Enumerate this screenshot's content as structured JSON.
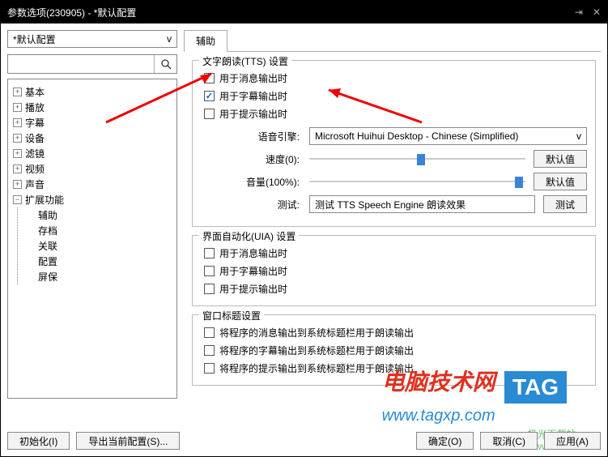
{
  "title": "参数选项(230905) - *默认配置",
  "configSelect": "*默认配置",
  "tree": {
    "items": [
      "基本",
      "播放",
      "字幕",
      "设备",
      "滤镜",
      "视频",
      "声音",
      "扩展功能"
    ],
    "children": [
      "辅助",
      "存档",
      "关联",
      "配置",
      "屏保"
    ]
  },
  "tab": "辅助",
  "tts": {
    "title": "文字朗读(TTS) 设置",
    "chk1": "用于消息输出时",
    "chk2": "用于字幕输出时",
    "chk3": "用于提示输出时",
    "engineLabel": "语音引擎:",
    "engineValue": "Microsoft Huihui Desktop - Chinese (Simplified)",
    "speedLabel": "速度(0):",
    "volumeLabel": "音量(100%):",
    "defaultBtn": "默认值",
    "testLabel": "测试:",
    "testInput": "测试 TTS Speech Engine 朗读效果",
    "testBtn": "测试"
  },
  "uia": {
    "title": "界面自动化(UIA) 设置",
    "chk1": "用于消息输出时",
    "chk2": "用于字幕输出时",
    "chk3": "用于提示输出时"
  },
  "winTitle": {
    "title": "窗口标题设置",
    "chk1": "将程序的消息输出到系统标题栏用于朗读输出",
    "chk2": "将程序的字幕输出到系统标题栏用于朗读输出",
    "chk3": "将程序的提示输出到系统标题栏用于朗读输出"
  },
  "bottom": {
    "init": "初始化(I)",
    "export": "导出当前配置(S)...",
    "ok": "确定(O)",
    "cancel": "取消(C)",
    "apply": "应用(A)"
  },
  "watermark": {
    "title": "电脑技术网",
    "tag": "TAG",
    "url": "www.tagxp.com",
    "aux": "极光下载站",
    "auxurl": "www.xz7.com"
  }
}
